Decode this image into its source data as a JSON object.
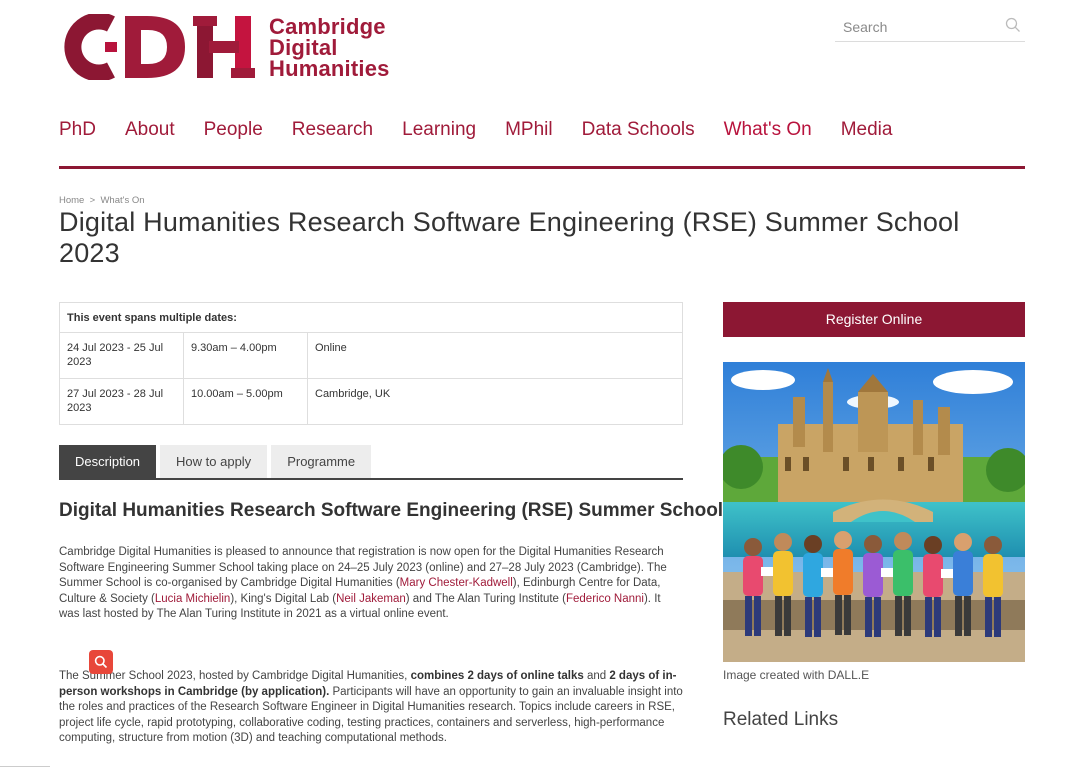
{
  "brand": {
    "line1": "Cambridge",
    "line2": "Digital",
    "line3": "Humanities",
    "color": "#a01b3a"
  },
  "search": {
    "placeholder": "Search",
    "icon": "search-icon"
  },
  "nav": {
    "items": [
      "PhD",
      "About",
      "People",
      "Research",
      "Learning",
      "MPhil",
      "Data Schools",
      "What's On",
      "Media"
    ],
    "active": "What's On"
  },
  "breadcrumb": {
    "home": "Home",
    "separator": ">",
    "current": "What's On"
  },
  "page": {
    "title": "Digital Humanities Research Software Engineering (RSE) Summer School 2023"
  },
  "dates": {
    "header": "This event spans multiple dates:",
    "rows": [
      {
        "date": "24 Jul 2023 - 25 Jul 2023",
        "time": "9.30am – 4.00pm",
        "location": "Online"
      },
      {
        "date": "27 Jul 2023 - 28 Jul 2023",
        "time": "10.00am – 5.00pm",
        "location": "Cambridge, UK"
      }
    ]
  },
  "tabs": [
    "Description",
    "How to apply",
    "Programme"
  ],
  "content": {
    "heading": "Digital Humanities Research Software Engineering (RSE) Summer School",
    "p1": {
      "t1": "Cambridge Digital Humanities is pleased to announce that registration is now open for the Digital Humanities Research Software Engineering Summer School taking place on 24–25 July 2023 (online) and 27–28 July 2023 (Cambridge). The Summer School is co-organised by Cambridge Digital Humanities (",
      "link1": "Mary Chester-Kadwell",
      "t2": "), Edinburgh Centre for Data, Culture & Society (",
      "link2": "Lucia Michielin",
      "t3": "), King's Digital Lab (",
      "link3": "Neil Jakeman",
      "t4": ") and The Alan Turing Institute (",
      "link4": "Federico Nanni",
      "t5": "). It was last hosted by The Alan Turing Institute in 2021 as a virtual online event."
    },
    "p2": {
      "t1": "The Summer School 2023, hosted by Cambridge Digital Humanities, ",
      "b1": "combines 2 days of online talks",
      "t2": " and ",
      "b2": "2 days of in-person workshops in Cambridge (by application).",
      "t3": " Participants will have an opportunity to gain an invaluable insight into the roles and practices of the Research Software Engineer in Digital Humanities research. Topics include careers in RSE, project life cycle, rapid prototyping, collaborative coding, testing practices, containers and serverless, high-performance computing, structure from motion (3D) and teaching computational methods."
    }
  },
  "sidebar": {
    "register_label": "Register Online",
    "image_caption": "Image created with DALL.E",
    "related_heading": "Related Links"
  },
  "colors": {
    "accent": "#a01b3a",
    "button": "#8c1733",
    "tab_active": "#444444"
  }
}
